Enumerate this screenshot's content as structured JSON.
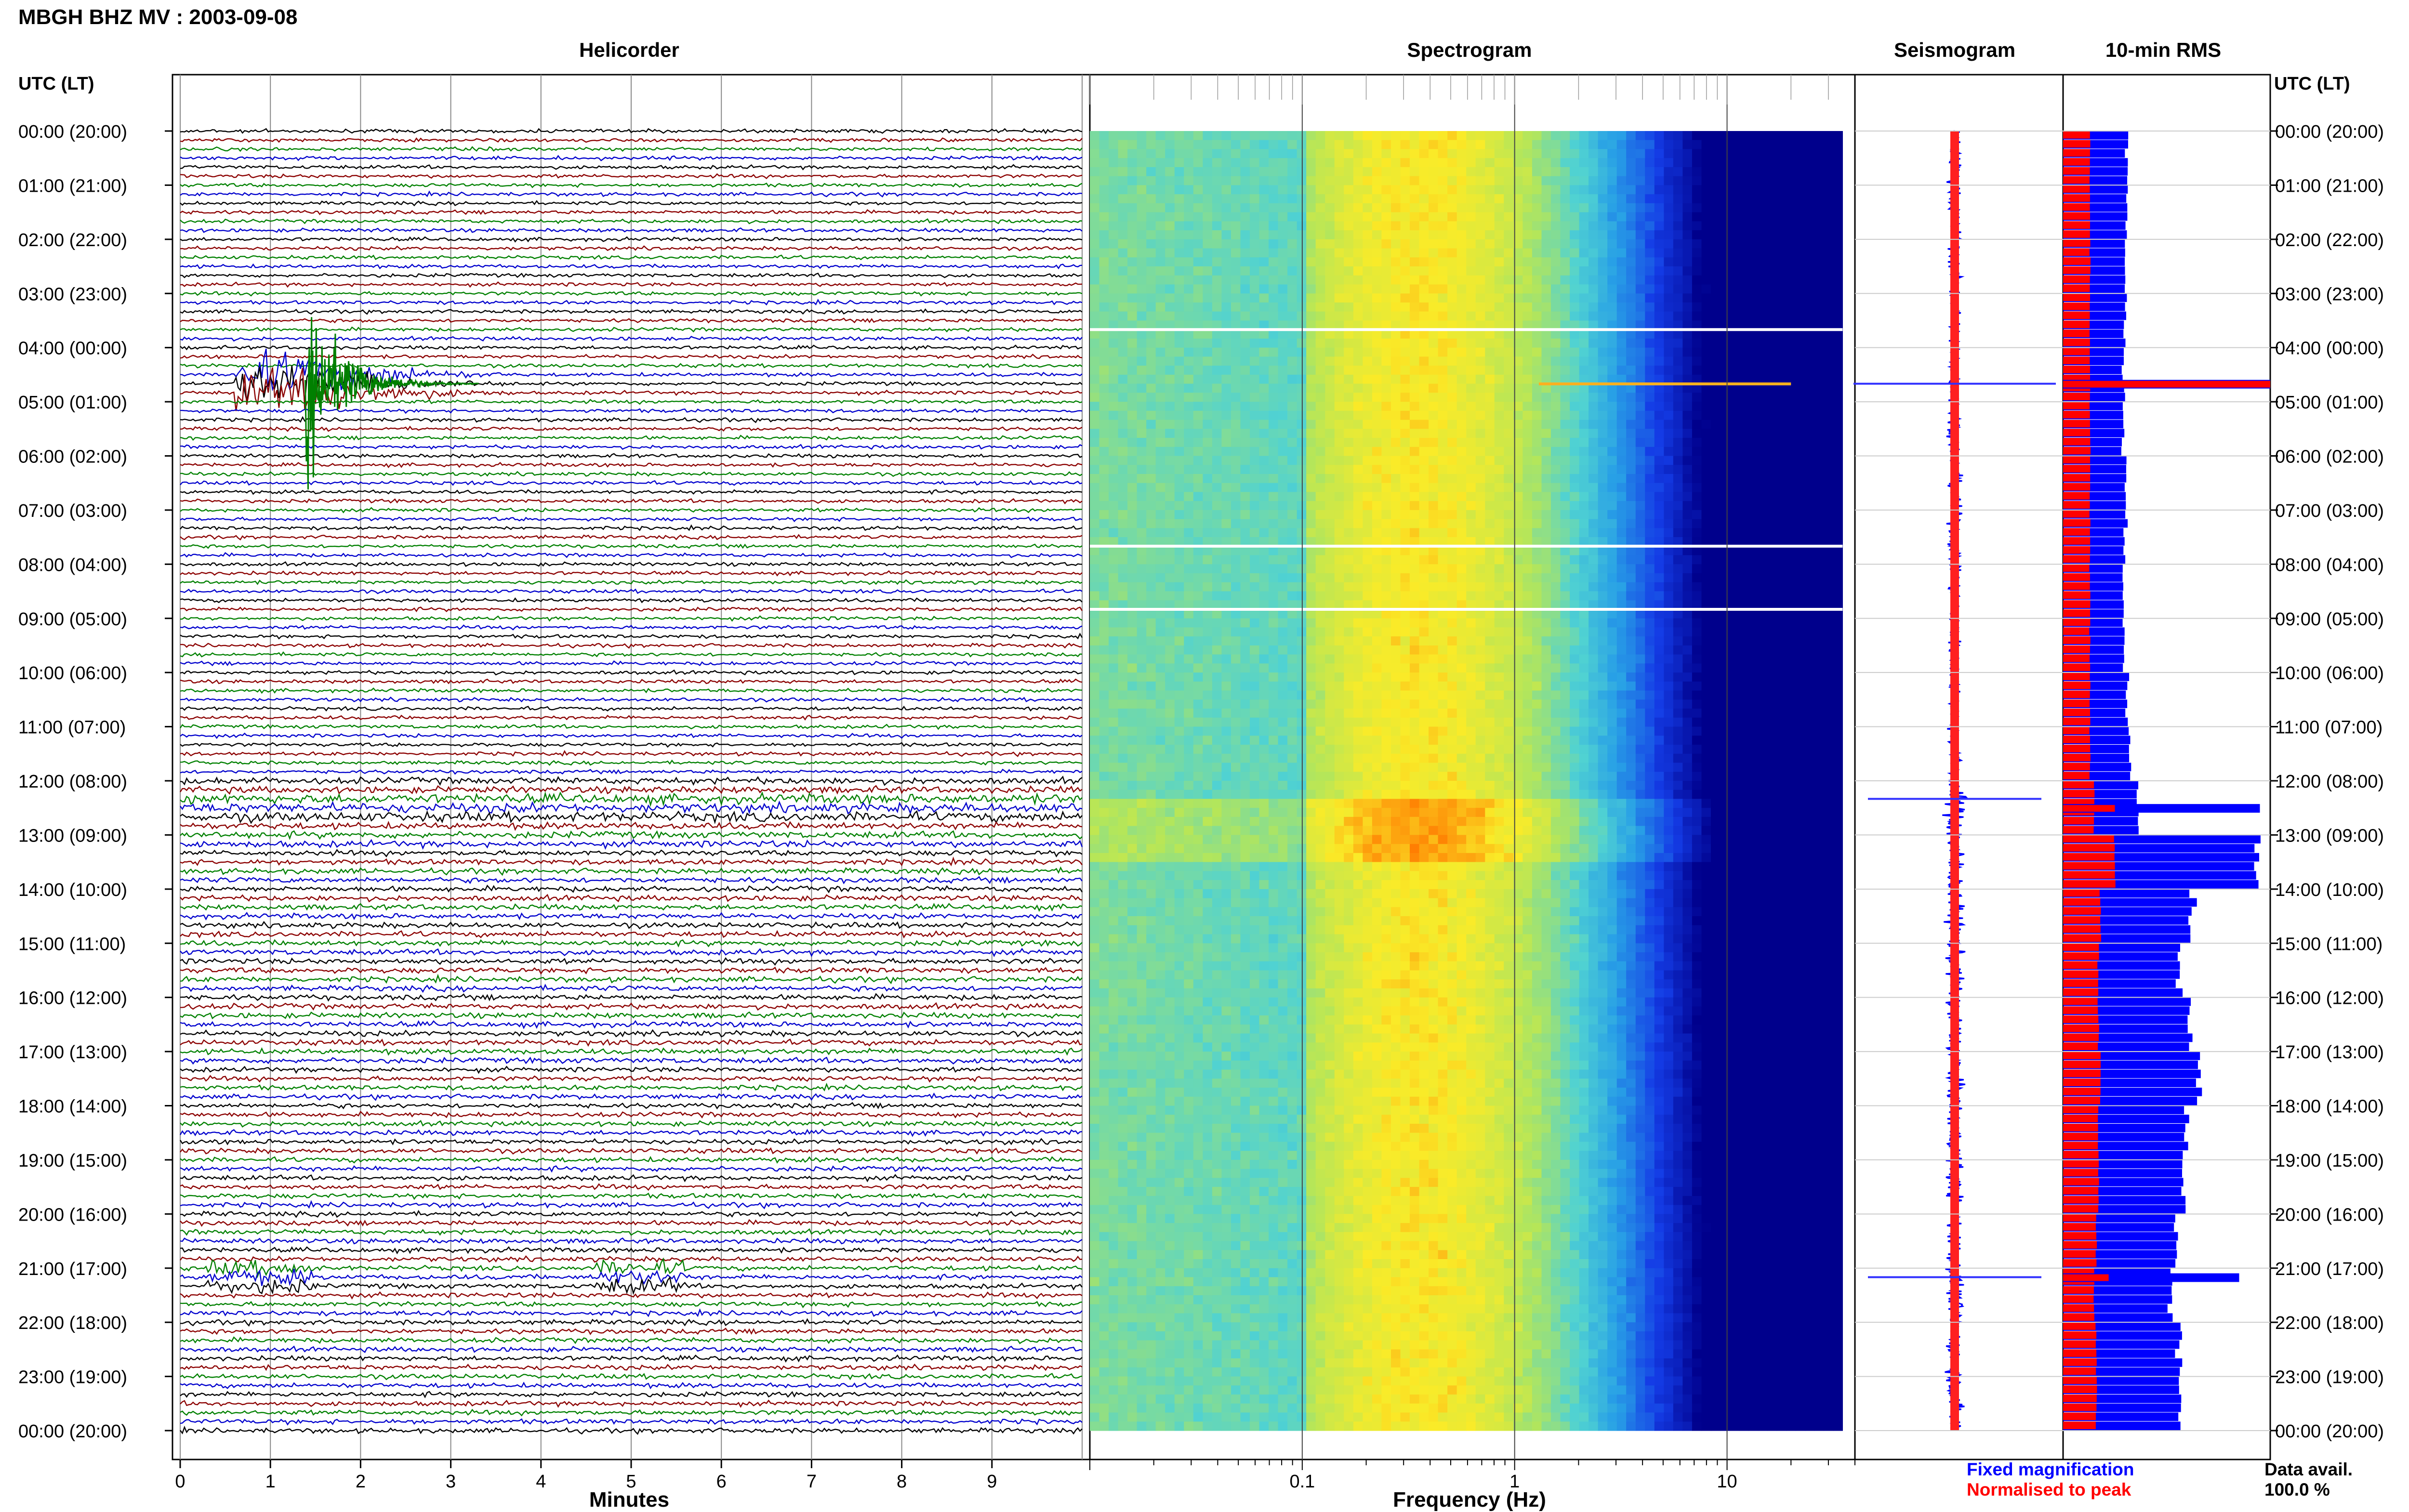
{
  "title": "MBGH BHZ MV : 2003-09-08",
  "panels": {
    "helicorder": "Helicorder",
    "spectrogram": "Spectrogram",
    "seismogram": "Seismogram",
    "rms": "10-min RMS"
  },
  "time_axis_header": "UTC (LT)",
  "time_labels": [
    "00:00 (20:00)",
    "01:00 (21:00)",
    "02:00 (22:00)",
    "03:00 (23:00)",
    "04:00 (00:00)",
    "05:00 (01:00)",
    "06:00 (02:00)",
    "07:00 (03:00)",
    "08:00 (04:00)",
    "09:00 (05:00)",
    "10:00 (06:00)",
    "11:00 (07:00)",
    "12:00 (08:00)",
    "13:00 (09:00)",
    "14:00 (10:00)",
    "15:00 (11:00)",
    "16:00 (12:00)",
    "17:00 (13:00)",
    "18:00 (14:00)",
    "19:00 (15:00)",
    "20:00 (16:00)",
    "21:00 (17:00)",
    "22:00 (18:00)",
    "23:00 (19:00)",
    "00:00 (20:00)"
  ],
  "legend": {
    "fixed": "Fixed magnification",
    "normalised": "Normalised to peak",
    "fixed_color": "#0000ff",
    "normalised_color": "#ff0000"
  },
  "data_avail": {
    "label": "Data avail.",
    "value": "100.0 %"
  },
  "colors": {
    "trace_cycle": [
      "#000000",
      "#8b0000",
      "#008000",
      "#0000cd"
    ],
    "rms_fixed": "#0000ff",
    "rms_norm": "#ff0000"
  },
  "chart_data": [
    {
      "type": "line",
      "name": "helicorder",
      "title": "Helicorder",
      "xlabel": "Minutes",
      "x_ticks": [
        0,
        1,
        2,
        3,
        4,
        5,
        6,
        7,
        8,
        9
      ],
      "xlim": [
        0,
        10
      ],
      "lines_per_hour": 6,
      "hours": 24,
      "events": [
        {
          "time_utc": "04:40",
          "minute": 1.6,
          "note": "large event"
        },
        {
          "time_utc": "21:10",
          "minute": 0.8,
          "note": "burst"
        }
      ]
    },
    {
      "type": "heatmap",
      "name": "spectrogram",
      "title": "Spectrogram",
      "xlabel": "Frequency (Hz)",
      "x_scale": "log",
      "x_tick_labels": [
        "0.1",
        "1",
        "10"
      ],
      "xlim": [
        0.01,
        40
      ],
      "peak_band_hz": [
        0.15,
        0.8
      ],
      "gaps_utc": [
        "03:40",
        "07:40",
        "08:50"
      ]
    },
    {
      "type": "line",
      "name": "seismogram",
      "title": "Seismogram",
      "events_utc": [
        "04:40",
        "12:20",
        "21:10"
      ]
    },
    {
      "type": "bar",
      "name": "10-min RMS",
      "title": "10-min RMS",
      "orientation": "horizontal",
      "fixed_hourly_width": [
        0.31,
        0.31,
        0.3,
        0.3,
        0.29,
        0.29,
        0.3,
        0.3,
        0.29,
        0.29,
        0.31,
        0.32,
        0.36,
        0.95,
        0.62,
        0.56,
        0.61,
        0.66,
        0.6,
        0.58,
        0.54,
        0.52,
        0.56,
        0.56
      ],
      "norm_hourly_width": [
        0.13,
        0.13,
        0.13,
        0.13,
        0.13,
        0.13,
        0.13,
        0.13,
        0.13,
        0.13,
        0.13,
        0.13,
        0.15,
        0.25,
        0.18,
        0.17,
        0.17,
        0.18,
        0.17,
        0.17,
        0.16,
        0.15,
        0.16,
        0.16
      ],
      "spikes": [
        {
          "time_utc": "04:40",
          "fixed": 1.0,
          "norm": 1.0
        },
        {
          "time_utc": "12:30",
          "fixed": 0.95,
          "norm": 0.25
        },
        {
          "time_utc": "21:10",
          "fixed": 0.85,
          "norm": 0.22
        }
      ]
    }
  ]
}
